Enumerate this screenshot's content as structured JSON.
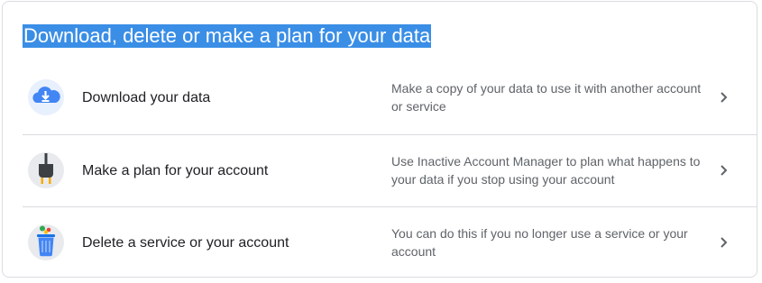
{
  "section": {
    "title": "Download, delete or make a plan for your data",
    "items": [
      {
        "label": "Download your data",
        "description": "Make a copy of your data to use it with another account or service",
        "icon": "cloud-download-icon"
      },
      {
        "label": "Make a plan for your account",
        "description": "Use Inactive Account Manager to plan what happens to your data if you stop using your account",
        "icon": "power-plug-icon"
      },
      {
        "label": "Delete a service or your account",
        "description": "You can do this if you no longer use a service or your account",
        "icon": "trash-bin-icon"
      }
    ]
  },
  "colors": {
    "title_highlight": "#3a8ee6",
    "text_primary": "#202124",
    "text_secondary": "#5f6368",
    "divider": "#dadce0",
    "icon_blue": "#4285f4"
  }
}
